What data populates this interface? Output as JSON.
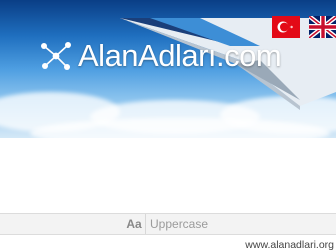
{
  "header": {
    "site_name": "AlanAdları.com",
    "logo_icon": "network-nodes-icon",
    "languages": [
      {
        "code": "tr",
        "icon": "flag-turkey-icon"
      },
      {
        "code": "en",
        "icon": "flag-uk-icon"
      }
    ]
  },
  "toolbar": {
    "case_label": "Aa",
    "case_option": "Uppercase"
  },
  "watermark": "www.alanadlari.org",
  "colors": {
    "sky_top": "#0a3e86",
    "sky_bottom": "#d4e8f7",
    "flag_red": "#e30a17",
    "uk_blue": "#012169",
    "uk_red": "#c8102e"
  }
}
